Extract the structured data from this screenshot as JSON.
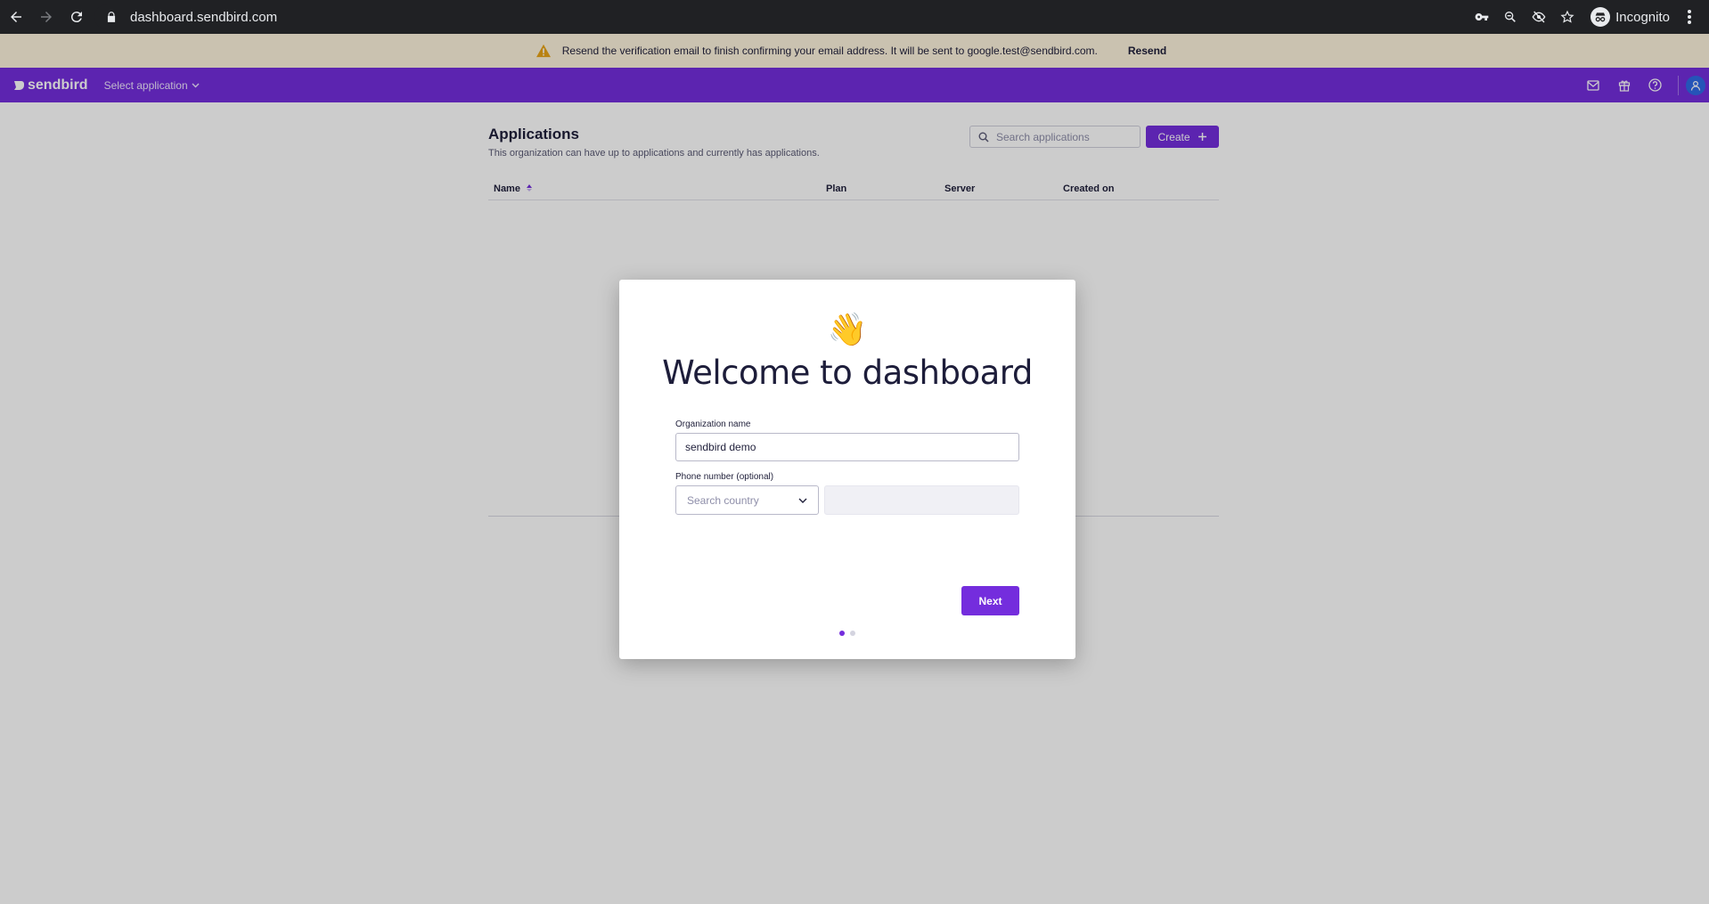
{
  "browser": {
    "url": "dashboard.sendbird.com",
    "profile_label": "Incognito"
  },
  "banner": {
    "message": "Resend the verification email to finish confirming your email address. It will be sent to google.test@sendbird.com.",
    "action_label": "Resend"
  },
  "header": {
    "brand": "sendbird",
    "app_selector_label": "Select application",
    "icons": [
      "mail-icon",
      "gift-icon",
      "help-icon",
      "user-icon"
    ]
  },
  "applications": {
    "title": "Applications",
    "subtitle": "This organization can have up to applications and currently has applications.",
    "search_placeholder": "Search applications",
    "create_label": "Create",
    "columns": [
      "Name",
      "Plan",
      "Server",
      "Created on"
    ]
  },
  "modal": {
    "emoji": "👋",
    "title": "Welcome to dashboard",
    "org_label": "Organization name",
    "org_value": "sendbird demo",
    "phone_label": "Phone number (optional)",
    "country_placeholder": "Search country",
    "phone_value": "",
    "next_label": "Next",
    "step_current": 1,
    "step_total": 2
  },
  "colors": {
    "brand": "#742ddd",
    "banner_bg": "#fdf3dc",
    "warning": "#e8a317"
  }
}
